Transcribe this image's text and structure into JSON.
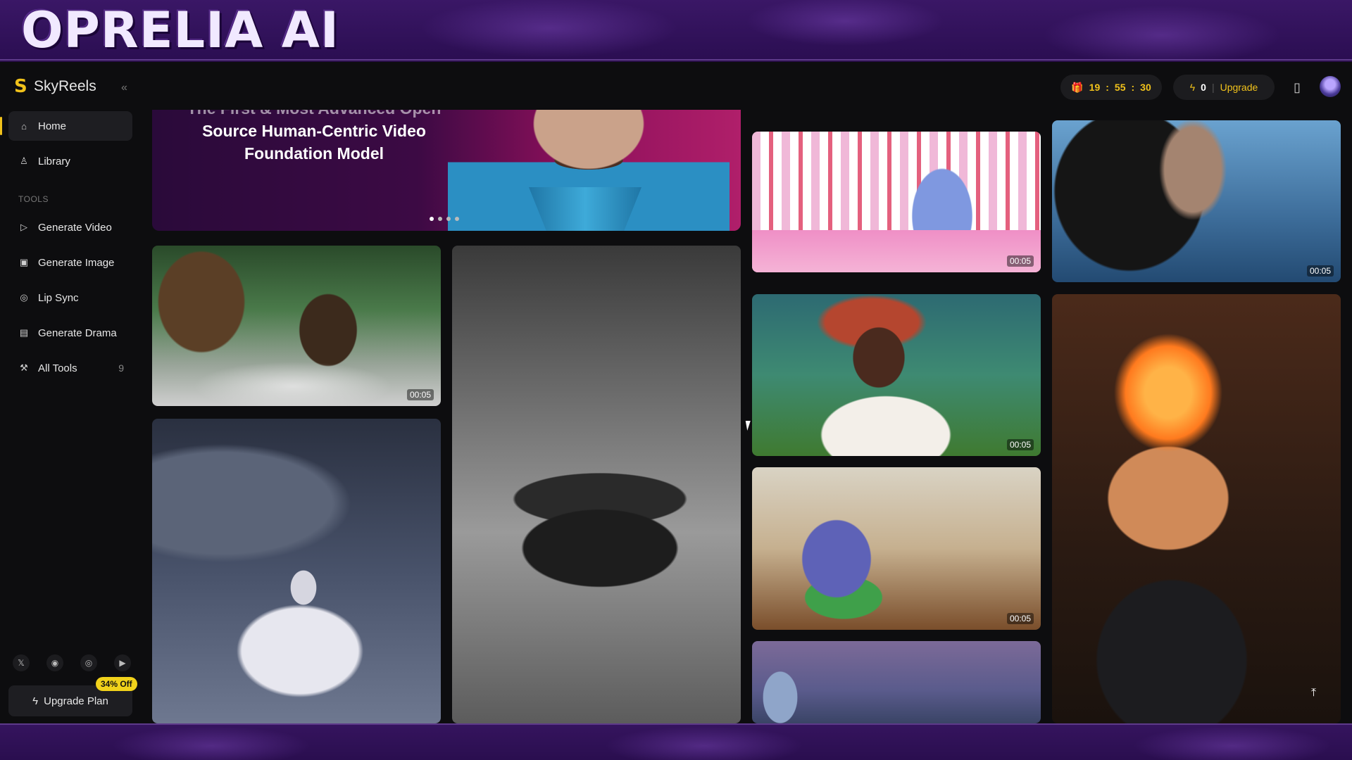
{
  "overlay": {
    "title": "OPRELIA AI"
  },
  "app": {
    "name": "SkyReels",
    "logo_glyph": "S",
    "collapse_glyph": "«"
  },
  "sidebar": {
    "items": [
      {
        "label": "Home",
        "icon": "home-icon",
        "glyph": "⌂"
      },
      {
        "label": "Library",
        "icon": "user-icon",
        "glyph": "♙"
      }
    ],
    "tools_label": "TOOLS",
    "tools": [
      {
        "label": "Generate Video",
        "icon": "play-circle-icon",
        "glyph": "▷"
      },
      {
        "label": "Generate Image",
        "icon": "image-icon",
        "glyph": "▣"
      },
      {
        "label": "Lip Sync",
        "icon": "lip-icon",
        "glyph": "◎"
      },
      {
        "label": "Generate Drama",
        "icon": "film-icon",
        "glyph": "▤"
      },
      {
        "label": "All Tools",
        "icon": "wrench-icon",
        "glyph": "⚒",
        "count": "9"
      }
    ],
    "socials": [
      {
        "icon": "x-icon",
        "glyph": "𝕏"
      },
      {
        "icon": "discord-icon",
        "glyph": "◉"
      },
      {
        "icon": "instagram-icon",
        "glyph": "◎"
      },
      {
        "icon": "youtube-icon",
        "glyph": "▶"
      }
    ],
    "upgrade_label": "Upgrade Plan",
    "upgrade_badge": "34% Off"
  },
  "topbar": {
    "timer": {
      "hours": "19",
      "minutes": "55",
      "seconds": "30",
      "sep": ":"
    },
    "credits": "0",
    "upgrade_label": "Upgrade"
  },
  "hero": {
    "line_cut": "The First & Most Advanced Open",
    "line1": "Source Human-Centric Video",
    "line2": "Foundation Model",
    "active_slide": 1,
    "slide_count": 4
  },
  "tiles": [
    {
      "name": "treehouse-video",
      "duration": "00:05"
    },
    {
      "name": "vintage-car-video",
      "duration": ""
    },
    {
      "name": "angel-video",
      "duration": ""
    },
    {
      "name": "candy-monster-video",
      "duration": "00:05"
    },
    {
      "name": "sea-face-video",
      "duration": "00:05"
    },
    {
      "name": "underwater-woman-video",
      "duration": "00:05"
    },
    {
      "name": "classroom-blob-video",
      "duration": "00:05"
    },
    {
      "name": "futuristic-city-video",
      "duration": ""
    },
    {
      "name": "fire-cat-video",
      "duration": ""
    }
  ],
  "colors": {
    "accent": "#f1c21b",
    "background": "#0d0d0f",
    "frame": "#2a0f4a"
  }
}
